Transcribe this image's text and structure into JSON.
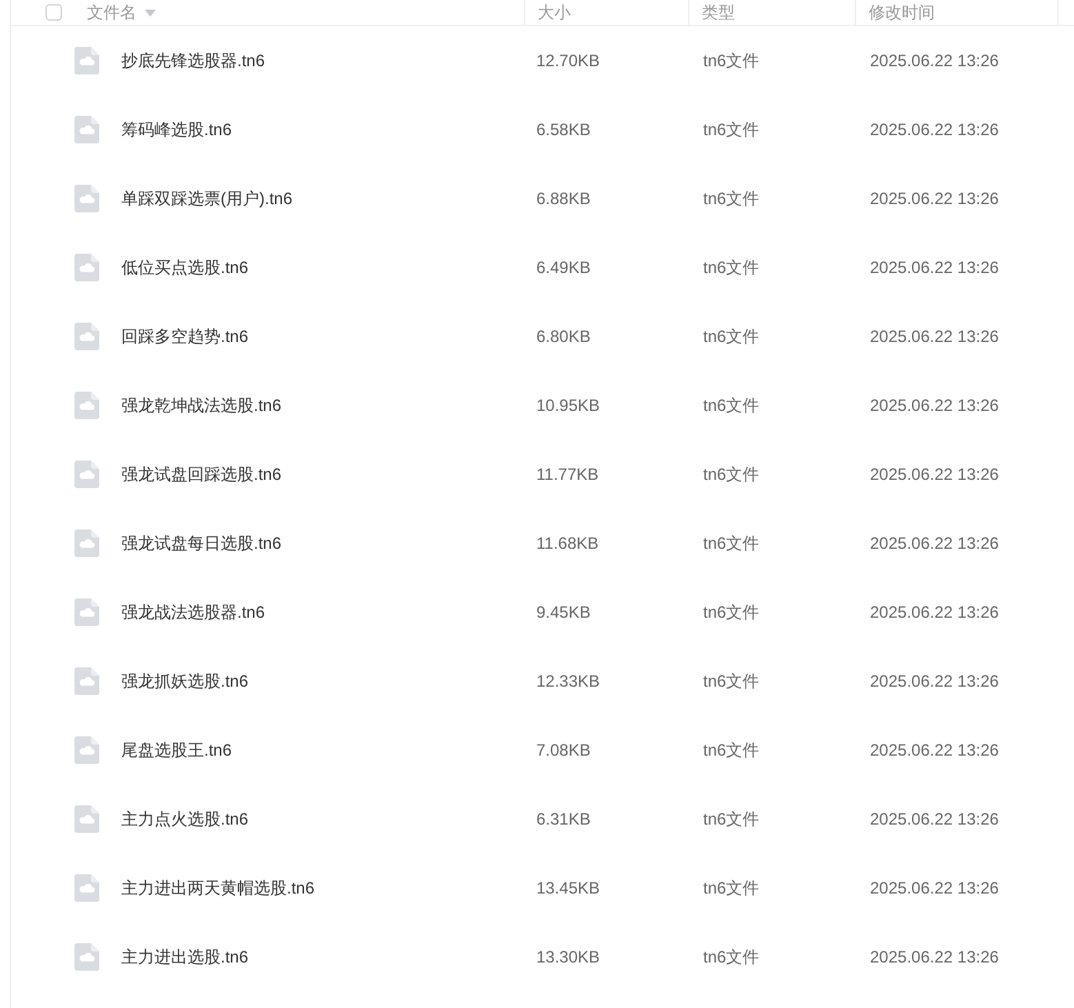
{
  "table": {
    "select_all": {
      "checked": false
    },
    "columns": [
      {
        "label": "文件名",
        "sorted": true
      },
      {
        "label": "大小",
        "sorted": false
      },
      {
        "label": "类型",
        "sorted": false
      },
      {
        "label": "修改时间",
        "sorted": false
      }
    ],
    "rows": [
      {
        "name": "抄底先锋选股器.tn6",
        "size": "12.70KB",
        "type": "tn6文件",
        "modified": "2025.06.22 13:26"
      },
      {
        "name": "筹码峰选股.tn6",
        "size": "6.58KB",
        "type": "tn6文件",
        "modified": "2025.06.22 13:26"
      },
      {
        "name": "单踩双踩选票(用户).tn6",
        "size": "6.88KB",
        "type": "tn6文件",
        "modified": "2025.06.22 13:26"
      },
      {
        "name": "低位买点选股.tn6",
        "size": "6.49KB",
        "type": "tn6文件",
        "modified": "2025.06.22 13:26"
      },
      {
        "name": "回踩多空趋势.tn6",
        "size": "6.80KB",
        "type": "tn6文件",
        "modified": "2025.06.22 13:26"
      },
      {
        "name": "强龙乾坤战法选股.tn6",
        "size": "10.95KB",
        "type": "tn6文件",
        "modified": "2025.06.22 13:26"
      },
      {
        "name": "强龙试盘回踩选股.tn6",
        "size": "11.77KB",
        "type": "tn6文件",
        "modified": "2025.06.22 13:26"
      },
      {
        "name": "强龙试盘每日选股.tn6",
        "size": "11.68KB",
        "type": "tn6文件",
        "modified": "2025.06.22 13:26"
      },
      {
        "name": "强龙战法选股器.tn6",
        "size": "9.45KB",
        "type": "tn6文件",
        "modified": "2025.06.22 13:26"
      },
      {
        "name": "强龙抓妖选股.tn6",
        "size": "12.33KB",
        "type": "tn6文件",
        "modified": "2025.06.22 13:26"
      },
      {
        "name": "尾盘选股王.tn6",
        "size": "7.08KB",
        "type": "tn6文件",
        "modified": "2025.06.22 13:26"
      },
      {
        "name": "主力点火选股.tn6",
        "size": "6.31KB",
        "type": "tn6文件",
        "modified": "2025.06.22 13:26"
      },
      {
        "name": "主力进出两天黄帽选股.tn6",
        "size": "13.45KB",
        "type": "tn6文件",
        "modified": "2025.06.22 13:26"
      },
      {
        "name": "主力进出选股.tn6",
        "size": "13.30KB",
        "type": "tn6文件",
        "modified": "2025.06.22 13:26"
      }
    ]
  }
}
